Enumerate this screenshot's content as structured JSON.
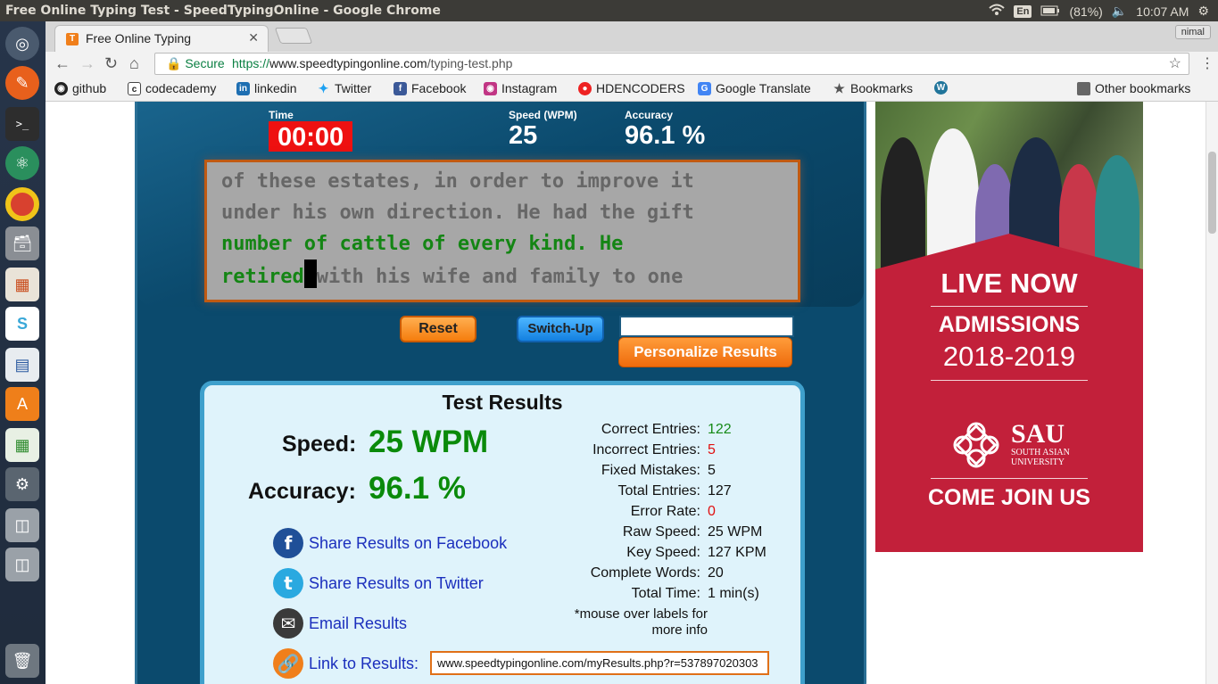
{
  "system": {
    "window_title": "Free Online Typing Test - SpeedTypingOnline - Google Chrome",
    "lang": "En",
    "battery": "(81%)",
    "clock": "10:07 AM"
  },
  "browser": {
    "tab_title": "Free Online Typing",
    "user": "nimal",
    "secure_label": "Secure",
    "url_scheme": "https://",
    "url_host": "www.speedtypingonline.com",
    "url_path": "/typing-test.php",
    "bookmarks": [
      "github",
      "codecademy",
      "linkedin",
      "Twitter",
      "Facebook",
      "Instagram",
      "HDENCODERS",
      "Google Translate",
      "Bookmarks"
    ],
    "other_bookmarks": "Other bookmarks"
  },
  "test": {
    "time_label": "Time",
    "time_value": "00:00",
    "speed_label": "Speed (WPM)",
    "speed_value": "25",
    "accuracy_label": "Accuracy",
    "accuracy_value": "96.1 %",
    "line1": "of these estates, in order to improve it",
    "line2": "under his own direction. He had the gift",
    "line3": "number of cattle of every kind. He",
    "line4_typed": "retired",
    "line4_rest": "with his wife and family to one",
    "reset_label": "Reset",
    "switch_label": "Switch-Up",
    "personalize_label": "Personalize Results"
  },
  "results": {
    "title": "Test Results",
    "speed_label": "Speed:",
    "speed_value": "25 WPM",
    "accuracy_label": "Accuracy:",
    "accuracy_value": "96.1 %",
    "share_facebook": "Share Results on Facebook",
    "share_twitter": "Share Results on Twitter",
    "email": "Email Results",
    "link_label": "Link to Results:",
    "link_value": "www.speedtypingonline.com/myResults.php?r=537897020303",
    "stats": [
      {
        "k": "Correct Entries:",
        "v": "122"
      },
      {
        "k": "Incorrect Entries:",
        "v": "5"
      },
      {
        "k": "Fixed Mistakes:",
        "v": "5"
      },
      {
        "k": "Total Entries:",
        "v": "127"
      },
      {
        "k": "Error Rate:",
        "v": "0"
      },
      {
        "k": "Raw Speed:",
        "v": "25 WPM"
      },
      {
        "k": "Key Speed:",
        "v": "127 KPM"
      },
      {
        "k": "Complete Words:",
        "v": "20"
      },
      {
        "k": "Total Time:",
        "v": "1 min(s)"
      }
    ],
    "note_line1": "*mouse over labels for",
    "note_line2": "more info"
  },
  "ad": {
    "live": "LIVE NOW",
    "admissions": "ADMISSIONS",
    "years": "2018-2019",
    "sau": "SAU",
    "univ1": "SOUTH ASIAN",
    "univ2": "UNIVERSITY",
    "join": "COME JOIN US"
  },
  "colors": {
    "accent_orange": "#f57d0d",
    "correct_green": "#168a16",
    "error_red": "#e01111",
    "panel_blue": "#0b4a6d"
  }
}
